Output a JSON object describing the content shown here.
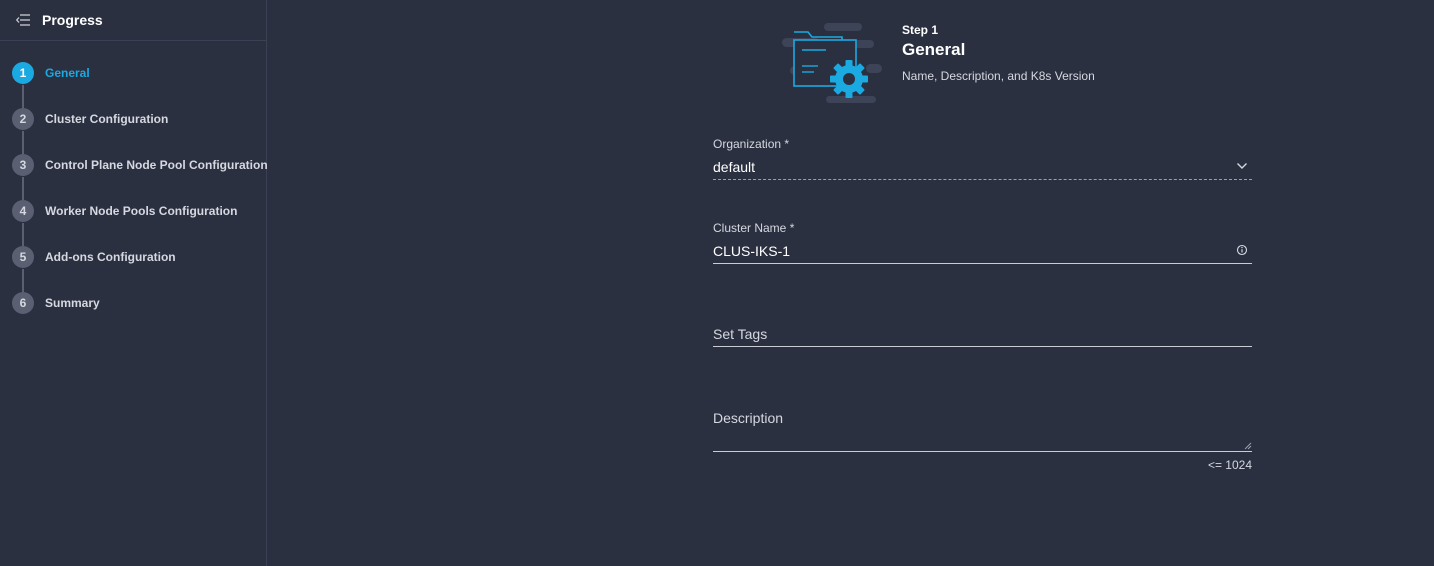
{
  "sidebar": {
    "title": "Progress",
    "steps": [
      {
        "num": "1",
        "label": "General",
        "active": true
      },
      {
        "num": "2",
        "label": "Cluster Configuration"
      },
      {
        "num": "3",
        "label": "Control Plane Node Pool Configuration"
      },
      {
        "num": "4",
        "label": "Worker Node Pools Configuration"
      },
      {
        "num": "5",
        "label": "Add-ons Configuration"
      },
      {
        "num": "6",
        "label": "Summary"
      }
    ]
  },
  "header": {
    "step_caption": "Step 1",
    "title": "General",
    "subtitle": "Name, Description, and K8s Version",
    "illustration": "folder-gear-illustration"
  },
  "form": {
    "organization": {
      "label": "Organization *",
      "value": "default"
    },
    "cluster_name": {
      "label": "Cluster Name *",
      "value": "CLUS-IKS-1"
    },
    "tags": {
      "placeholder": "Set Tags"
    },
    "description": {
      "placeholder": "Description",
      "limit": "<= 1024"
    }
  },
  "colors": {
    "background": "#2b3041",
    "accent": "#1ba9e1",
    "step_inactive": "#5a6071"
  }
}
